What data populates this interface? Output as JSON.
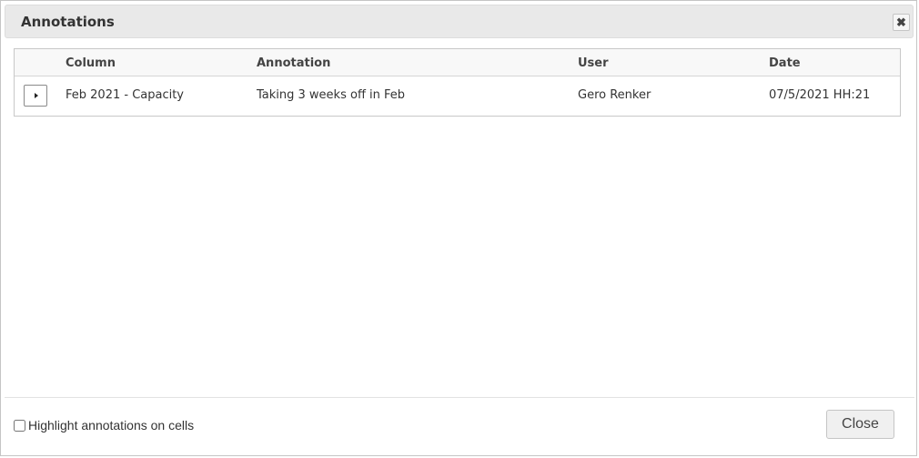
{
  "dialog": {
    "title": "Annotations",
    "close_icon_glyph": "✖"
  },
  "grid": {
    "columns": [
      "Column",
      "Annotation",
      "User",
      "Date"
    ],
    "rows": [
      {
        "column": "Feb 2021 - Capacity",
        "annotation": "Taking 3 weeks off in Feb",
        "user": "Gero Renker",
        "date": "07/5/2021 HH:21"
      }
    ]
  },
  "footer": {
    "checkbox_label": "Highlight annotations on cells",
    "checkbox_checked": false,
    "close_label": "Close"
  },
  "icons": {
    "close": "close-icon",
    "expand": "caret-right-icon"
  }
}
